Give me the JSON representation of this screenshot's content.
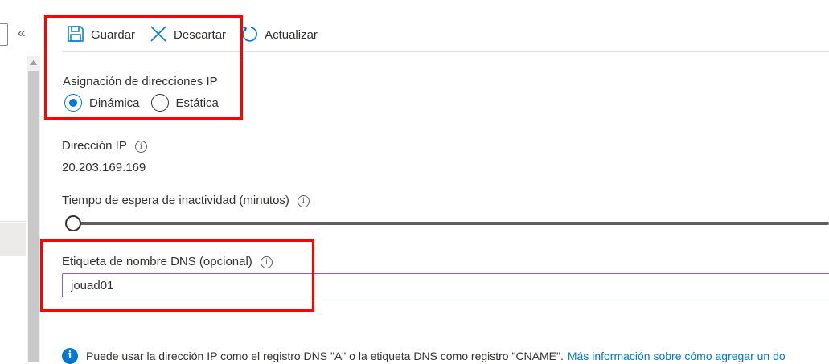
{
  "nav": {
    "collapse_glyph": "«"
  },
  "toolbar": {
    "save_label": "Guardar",
    "discard_label": "Descartar",
    "refresh_label": "Actualizar"
  },
  "ip_assignment": {
    "label": "Asignación de direcciones IP",
    "options": [
      {
        "label": "Dinámica",
        "checked": true
      },
      {
        "label": "Estática",
        "checked": false
      }
    ]
  },
  "ip_address": {
    "label": "Dirección IP",
    "value": "20.203.169.169"
  },
  "idle_timeout": {
    "label": "Tiempo de espera de inactividad (minutos)",
    "level": 0
  },
  "dns_label": {
    "label": "Etiqueta de nombre DNS (opcional)",
    "value": "jouad01"
  },
  "info_bar": {
    "text": "Puede usar la dirección IP como el registro DNS \"A\" o la etiqueta DNS como registro \"CNAME\".",
    "link": "Más información sobre cómo agregar un do"
  },
  "colors": {
    "accent": "#0078d4",
    "highlight": "#ff0000",
    "input_border": "#8a63a8"
  }
}
